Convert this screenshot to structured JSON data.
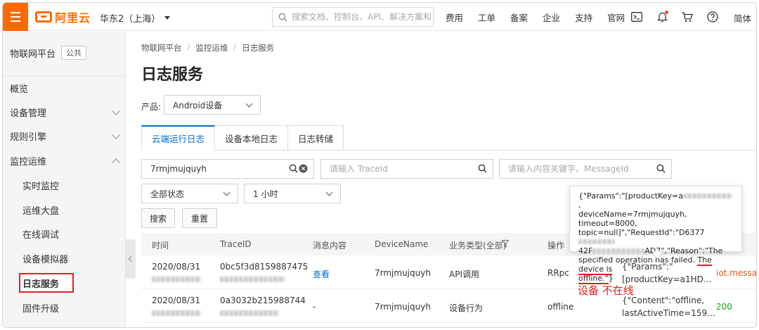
{
  "topbar": {
    "brand": "阿里云",
    "region": "华东2（上海）",
    "search_placeholder": "搜索文档、控制台、API、解决方案和资源",
    "links": [
      "费用",
      "工单",
      "备案",
      "企业",
      "支持",
      "官网"
    ],
    "lang": "简体"
  },
  "sidebar": {
    "title": "物联网平台",
    "badge": "公共",
    "items": [
      {
        "label": "概览"
      },
      {
        "label": "设备管理"
      },
      {
        "label": "规则引擎"
      },
      {
        "label": "监控运维"
      },
      {
        "label": "实时监控"
      },
      {
        "label": "运维大盘"
      },
      {
        "label": "在线调试"
      },
      {
        "label": "设备模拟器"
      },
      {
        "label": "日志服务"
      },
      {
        "label": "固件升级"
      }
    ]
  },
  "breadcrumb": [
    "物联网平台",
    "监控运维",
    "日志服务"
  ],
  "page_title": "日志服务",
  "product": {
    "label": "产品:",
    "value": "Android设备"
  },
  "tabs": [
    "云端运行日志",
    "设备本地日志",
    "日志转储"
  ],
  "filters": {
    "device_value": "7rmjmujquyh",
    "traceid_placeholder": "请输入 TraceId",
    "keyword_placeholder": "请输入内容关键字、MessageId",
    "status": "全部状态",
    "time": "1 小时",
    "search_btn": "搜索",
    "reset_btn": "重置"
  },
  "table": {
    "headers": [
      "时间",
      "TraceID",
      "消息内容",
      "DeviceName",
      "业务类型(全部)",
      "操作"
    ],
    "rows": [
      {
        "time": "2020/08/31",
        "traceid": "0bc5f3d8159887475",
        "content": "查看",
        "device": "7rmjmujquyh",
        "type": "API调用",
        "op": "RRpc",
        "detail_1": "{\"Params\":\"",
        "detail_2": "[productKey=a1HD...",
        "extra": "iot.message"
      },
      {
        "time": "2020/08/31",
        "traceid": "0a3032b215988744",
        "content": "-",
        "device": "7rmjmujquyh",
        "type": "设备行为",
        "op": "offline",
        "detail_1": "{\"Content\":\"offline,",
        "detail_2": "lastActiveTime=159...",
        "extra": "200"
      }
    ]
  },
  "popover": {
    "line1": "{\"Params\":\"[productKey=a",
    "line1_end": ",",
    "line2": "deviceName=7rmjmujquyh, timeout=8000,",
    "line3": "topic=null]\",\"RequestId\":\"D6377",
    "line4_start": "42F",
    "line4_end": "AD7\",\"Reason\":\"The",
    "line5a": "specified operation has failed. ",
    "line5b": "The device is",
    "line6a": "offline.\"",
    "line6b": "}"
  },
  "annotation": "设备 不在线",
  "colors": {
    "brand": "#ff6a00",
    "link": "#0070cc",
    "alert": "#e02020",
    "success": "#1a9d1a"
  }
}
